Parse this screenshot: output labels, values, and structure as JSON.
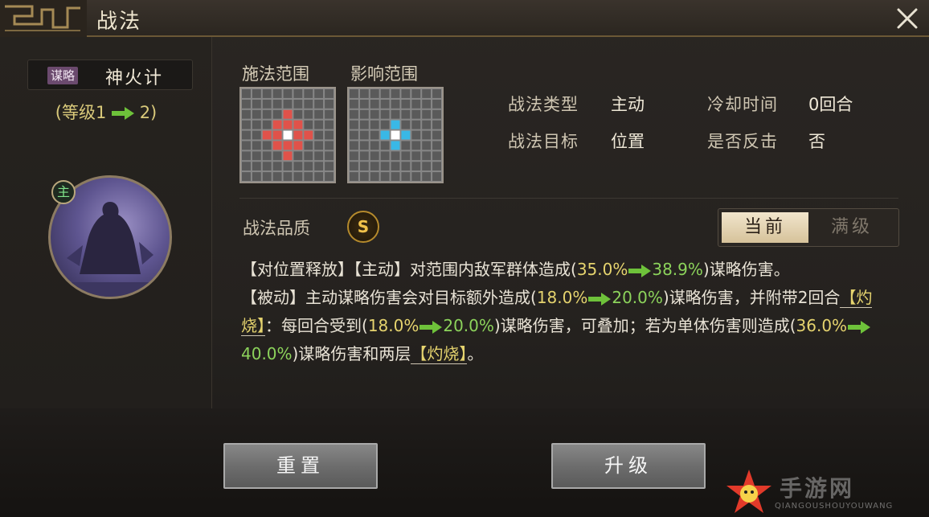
{
  "window": {
    "title": "战法"
  },
  "skill": {
    "category_tag": "谋略",
    "name": "神火计",
    "level_prefix": "(等级1",
    "level_suffix": "2)"
  },
  "hero": {
    "badge": "主"
  },
  "grids": {
    "cast_label": "施法范围",
    "effect_label": "影响范围",
    "size": 9,
    "cast_color": "#e0524a",
    "effect_color": "#39b8e6",
    "center_color": "#ffffff",
    "cast_cells": [
      [
        4,
        2
      ],
      [
        3,
        3
      ],
      [
        4,
        3
      ],
      [
        5,
        3
      ],
      [
        2,
        4
      ],
      [
        3,
        4
      ],
      [
        5,
        4
      ],
      [
        6,
        4
      ],
      [
        3,
        5
      ],
      [
        4,
        5
      ],
      [
        5,
        5
      ],
      [
        4,
        6
      ]
    ],
    "effect_cells": [
      [
        4,
        3
      ],
      [
        3,
        4
      ],
      [
        5,
        4
      ],
      [
        4,
        5
      ]
    ],
    "center": [
      4,
      4
    ]
  },
  "info": {
    "type_label": "战法类型",
    "type_value": "主动",
    "cooldown_label": "冷却时间",
    "cooldown_value": "0回合",
    "target_label": "战法目标",
    "target_value": "位置",
    "counter_label": "是否反击",
    "counter_value": "否"
  },
  "quality": {
    "label": "战法品质",
    "grade": "S"
  },
  "toggle": {
    "current": "当前",
    "max": "满级"
  },
  "description": {
    "p1_a": "【对位置释放】【主动】对范围内敌军群体造成(",
    "p1_v1": "35.0%",
    "p1_v2": "38.9%",
    "p1_b": ")谋略伤害。",
    "p2_a": "【被动】主动谋略伤害会对目标额外造成(",
    "p2_v1": "18.0%",
    "p2_v2": "20.0%",
    "p2_b": ")谋略伤害，并附带2回合",
    "burn1": "【灼烧】",
    "p2_c": "：每回合受到(",
    "p2_v3": "18.0%",
    "p2_v4": "20.0%",
    "p2_d": ")谋略伤害，可叠加；若为单体伤害则造成(",
    "p2_v5": "36.0%",
    "p2_v6": "40.0%",
    "p2_e": ")谋略伤害和两层",
    "burn2": "【灼烧】",
    "p2_f": "。"
  },
  "buttons": {
    "reset": "重置",
    "upgrade": "升级"
  },
  "watermark": {
    "text": "手游网",
    "sub": "QIANGOUSHOUYOUWANG"
  }
}
